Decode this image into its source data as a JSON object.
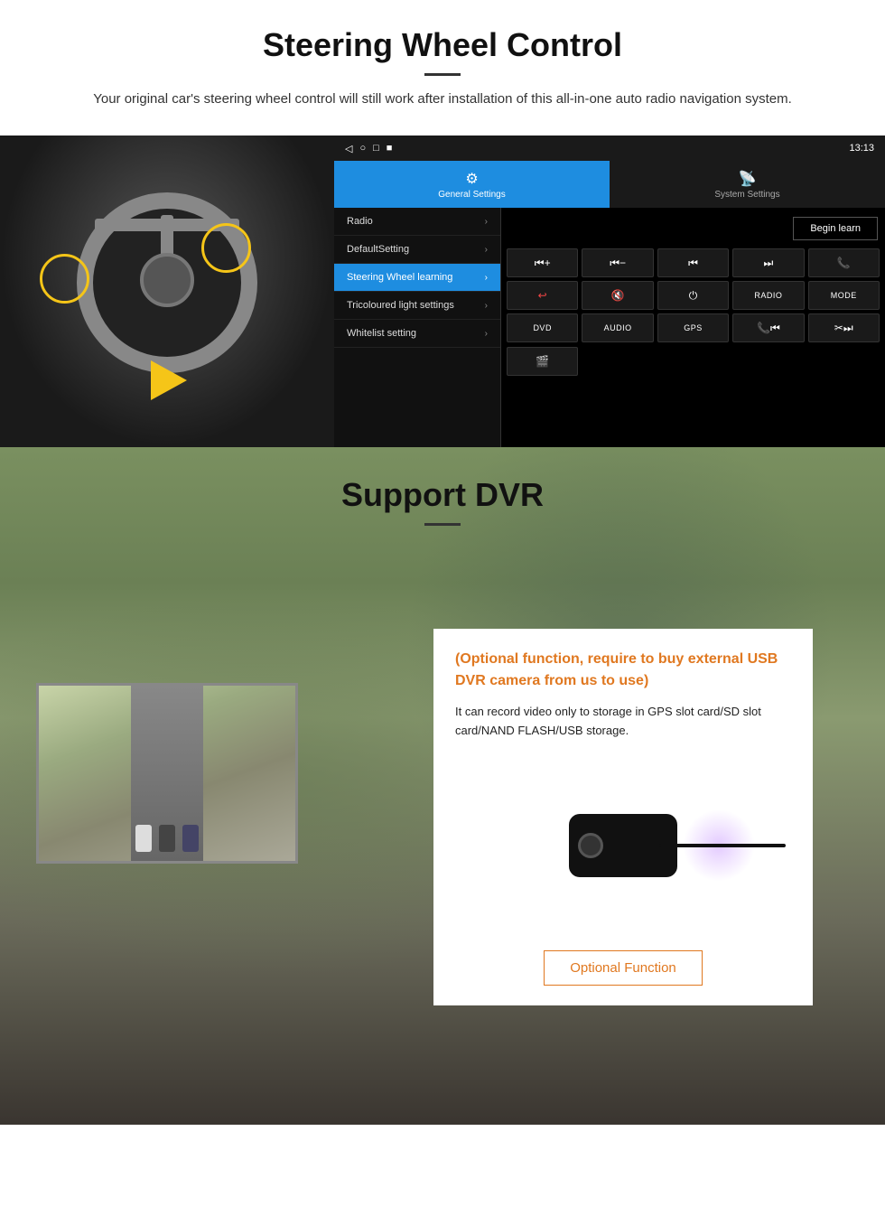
{
  "section1": {
    "title": "Steering Wheel Control",
    "subtitle": "Your original car's steering wheel control will still work after installation of this all-in-one auto radio navigation system.",
    "statusbar": {
      "time": "13:13",
      "icons": [
        "◁",
        "○",
        "□",
        "■"
      ]
    },
    "tabs": [
      {
        "id": "general",
        "icon": "⚙",
        "label": "General Settings",
        "active": true
      },
      {
        "id": "system",
        "icon": "📡",
        "label": "System Settings",
        "active": false
      }
    ],
    "menu_items": [
      {
        "label": "Radio",
        "active": false
      },
      {
        "label": "DefaultSetting",
        "active": false
      },
      {
        "label": "Steering Wheel learning",
        "active": true
      },
      {
        "label": "Tricoloured light settings",
        "active": false
      },
      {
        "label": "Whitelist setting",
        "active": false
      }
    ],
    "begin_learn": "Begin learn",
    "control_buttons": [
      "⏮+",
      "⏮−",
      "⏮⏮",
      "⏭⏭",
      "📞",
      "↩",
      "🔇",
      "⏻",
      "RADIO",
      "MODE",
      "DVD",
      "AUDIO",
      "GPS",
      "📞⏮",
      "✂⏭"
    ]
  },
  "section2": {
    "title": "Support DVR",
    "info_title": "(Optional function, require to buy external USB DVR camera from us to use)",
    "info_desc": "It can record video only to storage in GPS slot card/SD slot card/NAND FLASH/USB storage.",
    "optional_function_btn": "Optional Function"
  }
}
